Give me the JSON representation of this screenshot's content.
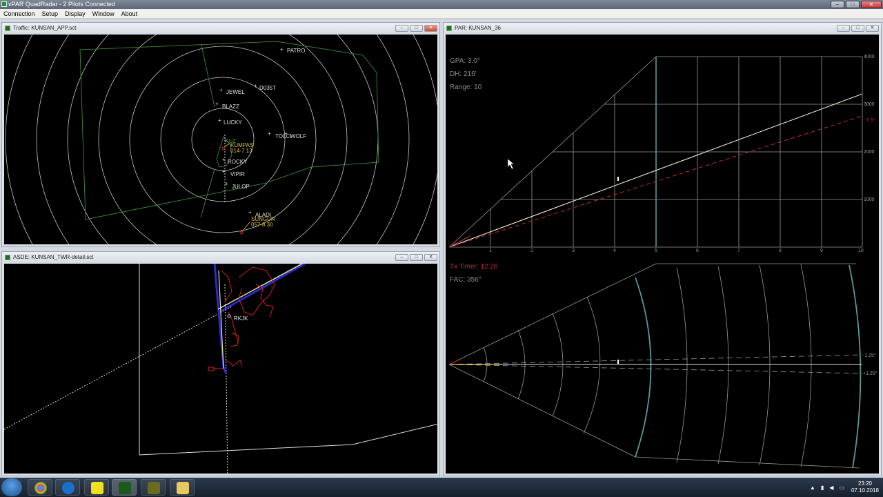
{
  "app": {
    "title": "vPAR QuadRadar - 2 Pilots Connected",
    "menu": [
      "Connection",
      "Setup",
      "Display",
      "Window",
      "About"
    ]
  },
  "windows": {
    "traffic": {
      "title": "Traffic: KUNSAN_APP.sct",
      "fixes": [
        "PATRO",
        "JEWEL",
        "D035T",
        "BLAZZ",
        "LUCKY",
        "TOLCI",
        "WOLF",
        "KUZ",
        "KUMPAS",
        "ROCKY",
        "VIPIR",
        "JULOP",
        "ALADI",
        "SUNGUR"
      ],
      "datablock_1": "014-7 13",
      "datablock_2": "057-8 30"
    },
    "asde": {
      "title": "ASDE: KUNSAN_TWR-detail.sct",
      "label": "RKJK"
    },
    "par": {
      "title": "PAR: KUNSAN_36",
      "gpa": "GPA: 3.0°",
      "dh": "DH: 216'",
      "range": "Range: 10",
      "tx_timer": "Tx Timer: 12:26",
      "fac": "FAC: 356°",
      "alt_labels": [
        "4000",
        "3000",
        "2000",
        "1000"
      ],
      "glide_offset_label": "-0.5°",
      "range_ticks": [
        "1",
        "2",
        "3",
        "4",
        "5",
        "6",
        "7",
        "8",
        "9",
        "10"
      ],
      "az_labels": [
        "-1.25°",
        "+1.25°"
      ]
    }
  },
  "taskbar": {
    "time": "23:20",
    "date": "07.10.2018",
    "tray_up": "▲"
  },
  "colors": {
    "radar_ring": "#c8c8c8",
    "sector_line": "#3a8a3a",
    "asde_runway_blue": "#2a2ad0",
    "asde_red": "#d02020",
    "par_glide": "#f0f0c8",
    "par_offset": "#c03030",
    "tx_timer": "#c03030"
  }
}
